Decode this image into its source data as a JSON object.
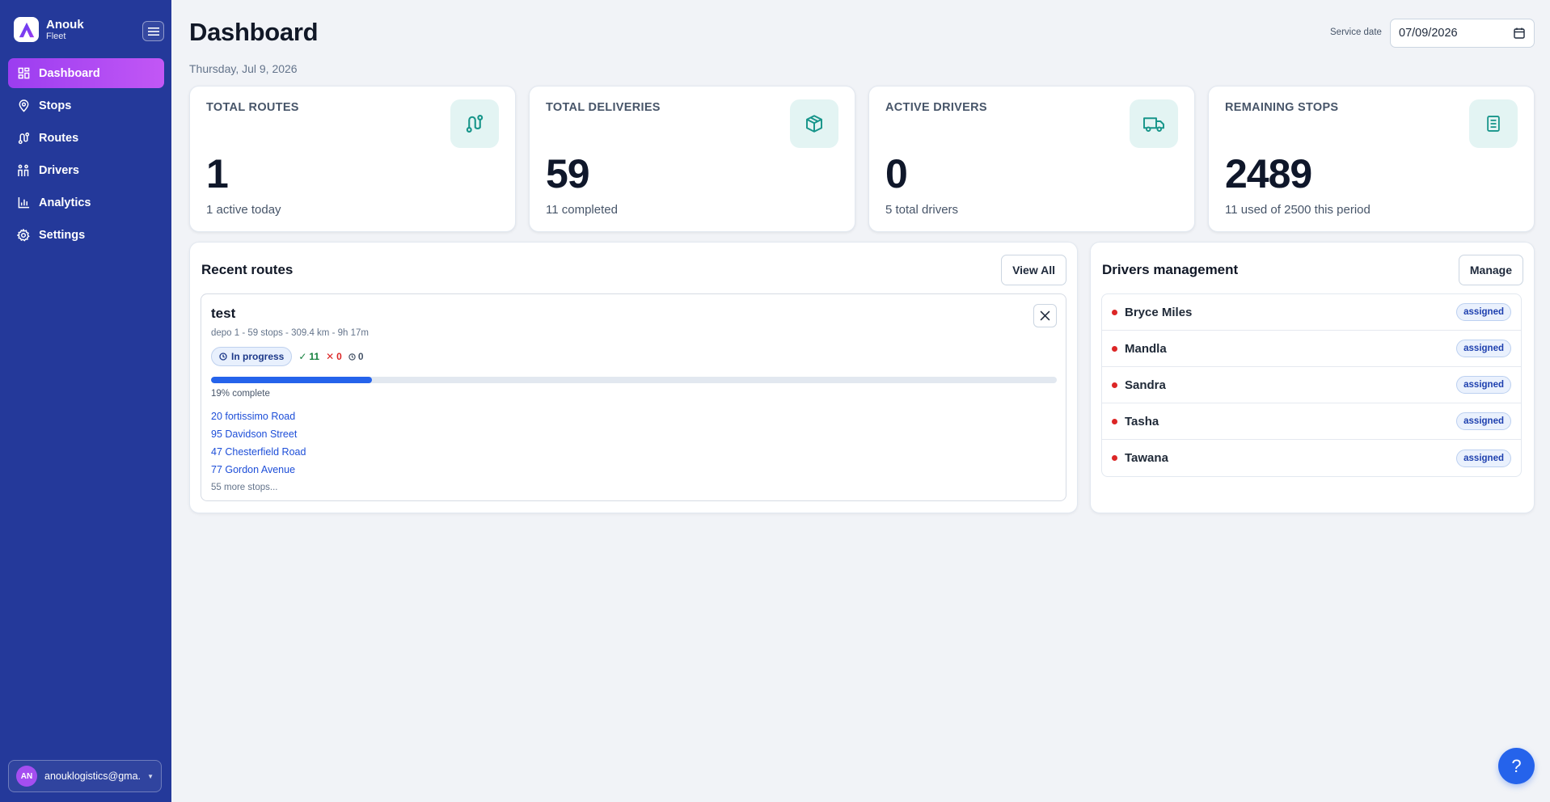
{
  "brand": {
    "name": "Anouk",
    "subtitle": "Fleet"
  },
  "nav": [
    {
      "label": "Dashboard",
      "icon": "dashboard-icon",
      "active": true
    },
    {
      "label": "Stops",
      "icon": "map-pin-icon"
    },
    {
      "label": "Routes",
      "icon": "route-icon"
    },
    {
      "label": "Drivers",
      "icon": "drivers-icon"
    },
    {
      "label": "Analytics",
      "icon": "bar-chart-icon"
    },
    {
      "label": "Settings",
      "icon": "gear-icon"
    }
  ],
  "account": {
    "initials": "AN",
    "email": "anouklogistics@gma..."
  },
  "header": {
    "title": "Dashboard",
    "date": "Thursday, Jul 9, 2026",
    "service_date_label": "Service date",
    "service_date_value": "07/09/2026"
  },
  "stats": [
    {
      "label": "TOTAL ROUTES",
      "value": "1",
      "sub": "1 active today",
      "icon": "route-icon"
    },
    {
      "label": "TOTAL DELIVERIES",
      "value": "59",
      "sub": "11 completed",
      "icon": "package-icon"
    },
    {
      "label": "ACTIVE DRIVERS",
      "value": "0",
      "sub": "5 total drivers",
      "icon": "truck-icon"
    },
    {
      "label": "REMAINING STOPS",
      "value": "2489",
      "sub": "11 used of 2500 this period",
      "icon": "document-icon"
    }
  ],
  "recent_routes": {
    "title": "Recent routes",
    "view_all_label": "View All",
    "route": {
      "name": "test",
      "meta": "depo 1 - 59 stops - 309.4 km - 9h 17m",
      "status": "In progress",
      "completed_count": "11",
      "failed_count": "0",
      "pending_count": "0",
      "progress": 0.19,
      "progress_label": "19% complete",
      "stops": [
        "20 fortissimo Road",
        "95 Davidson Street",
        "47 Chesterfield Road",
        "77 Gordon Avenue"
      ],
      "more_stops": "55 more stops..."
    }
  },
  "drivers_management": {
    "title": "Drivers management",
    "manage_label": "Manage",
    "drivers": [
      {
        "name": "Bryce Miles",
        "status": "assigned"
      },
      {
        "name": "Mandla",
        "status": "assigned"
      },
      {
        "name": "Sandra",
        "status": "assigned"
      },
      {
        "name": "Tasha",
        "status": "assigned"
      },
      {
        "name": "Tawana",
        "status": "assigned"
      }
    ]
  },
  "help": {
    "label": "?"
  },
  "colors": {
    "sidebar": "#24399a",
    "active_nav": "#a944f2",
    "accent_blue": "#2563eb",
    "teal_icon": "#17958a",
    "status_red": "#dc2626",
    "success_green": "#15803d"
  }
}
